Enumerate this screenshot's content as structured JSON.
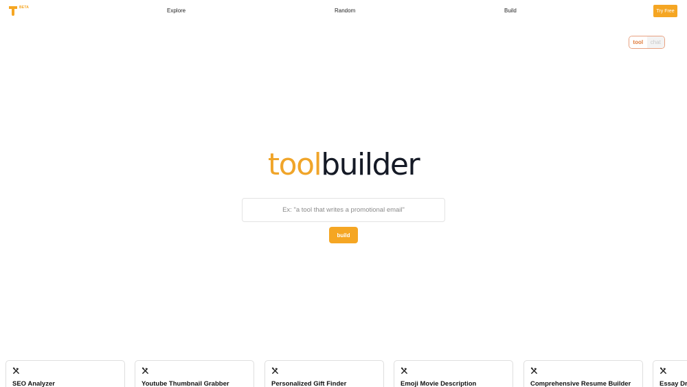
{
  "nav": {
    "logo_letter": "T",
    "logo_badge": "BETA",
    "links": [
      "Explore",
      "Random",
      "Build"
    ],
    "cta_label": "Try Free"
  },
  "mode_toggle": {
    "options": [
      "tool",
      "chat"
    ],
    "selected": "tool"
  },
  "brand": {
    "part1": "tool",
    "part2": "builder"
  },
  "search": {
    "placeholder": "Ex: \"a tool that writes a promotional email\"",
    "value": ""
  },
  "build_button": {
    "label": "build"
  },
  "cards": [
    {
      "icon": "tools-icon",
      "title": "SEO Analyzer"
    },
    {
      "icon": "tools-icon",
      "title": "Youtube Thumbnail Grabber"
    },
    {
      "icon": "tools-icon",
      "title": "Personalized Gift Finder"
    },
    {
      "icon": "tools-icon",
      "title": "Emoji Movie Description"
    },
    {
      "icon": "tools-icon",
      "title": "Comprehensive Resume Builder"
    },
    {
      "icon": "tools-icon",
      "title": "Essay Dra"
    }
  ],
  "colors": {
    "accent": "#f5a623",
    "brand_dark": "#151a26",
    "toggle_border": "#e8a07f"
  }
}
